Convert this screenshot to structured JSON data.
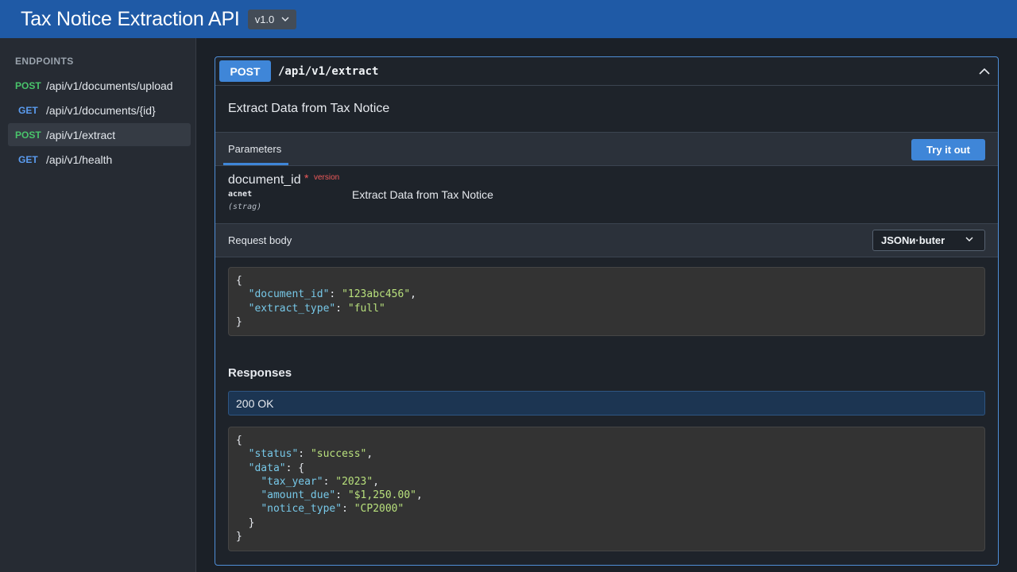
{
  "header": {
    "title": "Tax Notice Extraction API",
    "version": "v1.0"
  },
  "sidebar": {
    "heading": "ENDPOINTS",
    "items": [
      {
        "method": "POST",
        "path": "/api/v1/documents/upload",
        "active": false
      },
      {
        "method": "GET",
        "path": "/api/v1/documents/{id}",
        "active": false
      },
      {
        "method": "POST",
        "path": "/api/v1/extract",
        "active": true
      },
      {
        "method": "GET",
        "path": "/api/v1/health",
        "active": false
      }
    ]
  },
  "operation": {
    "method": "POST",
    "path": "/api/v1/extract",
    "summary": "Extract Data from Tax Notice",
    "parameters_label": "Parameters",
    "try_button": "Try it out",
    "parameter": {
      "name": "document_id",
      "required_mark": "*",
      "flag": "version",
      "in": "acnet",
      "type": "(strag)",
      "description": "Extract Data from Tax Notice"
    },
    "request_body_label": "Request body",
    "content_type": "JSONи·buter",
    "request_example": {
      "open": "{",
      "lines": [
        {
          "key": "\"document_id\"",
          "value": "\"123abc456\""
        },
        {
          "key": "\"extract_type\"",
          "value": "\"full\""
        }
      ],
      "close": "}"
    },
    "responses_label": "Responses",
    "response_status": "200 OK",
    "response_example": {
      "open": "{",
      "status_key": "\"status\"",
      "status_value": "\"success\"",
      "data_key": "\"data\"",
      "data_open": "{",
      "data_lines": [
        {
          "key": "\"tax_year\"",
          "value": "\"2023\""
        },
        {
          "key": "\"amount_due\"",
          "value": "\"$1,250.00\""
        },
        {
          "key": "\"notice_type\"",
          "value": "\"CP2000\""
        }
      ],
      "data_close": "}",
      "close": "}"
    }
  },
  "colors": {
    "header_bg": "#1f5aa6",
    "post": "#49c46b",
    "get": "#5b9cf0",
    "accent": "#3f86d8",
    "required": "#ef5a5a"
  },
  "icons": {
    "version_dropdown": "chevron-down-icon",
    "collapse": "chevron-up-icon",
    "content_type_dropdown": "chevron-down-icon"
  }
}
